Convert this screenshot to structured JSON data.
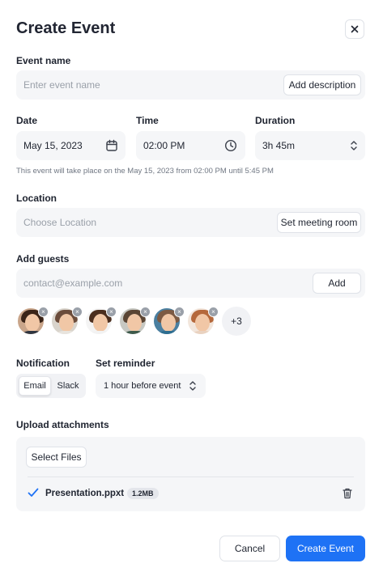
{
  "dialog": {
    "title": "Create Event"
  },
  "event_name": {
    "label": "Event name",
    "placeholder": "Enter event name",
    "add_description_label": "Add description"
  },
  "date": {
    "label": "Date",
    "value": "May 15, 2023",
    "icon": "calendar-icon"
  },
  "time": {
    "label": "Time",
    "value": "02:00 PM",
    "icon": "clock-icon"
  },
  "duration": {
    "label": "Duration",
    "value": "3h 45m",
    "icon": "chevron-updown-icon"
  },
  "summary": "This event will take place on the May 15, 2023 from 02:00 PM until 5:45 PM",
  "location": {
    "label": "Location",
    "placeholder": "Choose Location",
    "button_label": "Set meeting room"
  },
  "guests": {
    "label": "Add guests",
    "placeholder": "contact@example.com",
    "add_label": "Add",
    "avatars": [
      {
        "hair": "#3a2418",
        "shirt": "#2f3540",
        "bg": "#c9a58a"
      },
      {
        "hair": "#6b4c3b",
        "shirt": "#e8e4de",
        "bg": "#d9d4cc"
      },
      {
        "hair": "#4b2e1e",
        "shirt": "#f2f2f2",
        "bg": "#f4f4f4"
      },
      {
        "hair": "#5a4534",
        "shirt": "#3d5a4b",
        "bg": "#c7c8c2"
      },
      {
        "hair": "#7c5a43",
        "shirt": "#2d6d8f",
        "bg": "#4a7fa0"
      },
      {
        "hair": "#b5683b",
        "shirt": "#e9d2c0",
        "bg": "#f2e6dc"
      }
    ],
    "more_count": "+3"
  },
  "notification": {
    "label": "Notification",
    "options": [
      "Email",
      "Slack"
    ],
    "selected": "Email"
  },
  "reminder": {
    "label": "Set reminder",
    "value": "1 hour before event"
  },
  "attachments": {
    "label": "Upload attachments",
    "select_label": "Select Files",
    "files": [
      {
        "name": "Presentation.ppxt",
        "size": "1.2MB"
      }
    ]
  },
  "footer": {
    "cancel_label": "Cancel",
    "create_label": "Create Event"
  },
  "colors": {
    "primary": "#1e72f5",
    "check": "#1e72f5"
  }
}
